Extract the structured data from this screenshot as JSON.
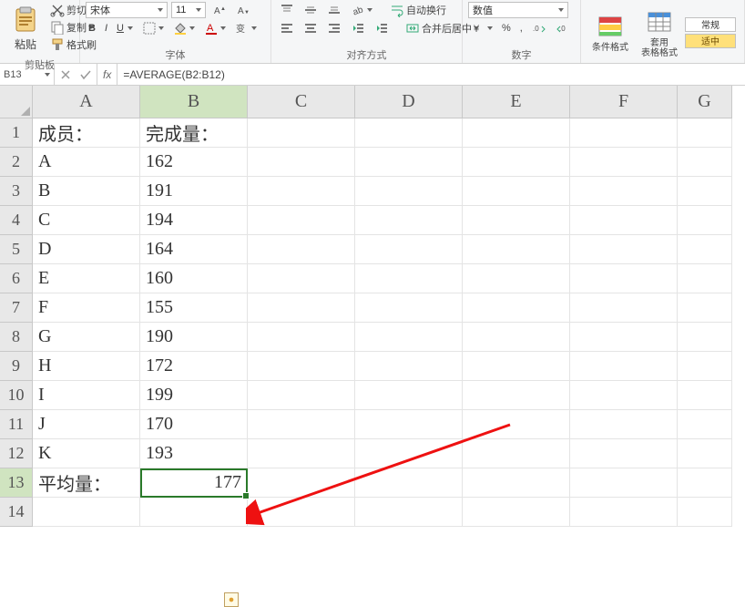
{
  "ribbon": {
    "clipboard": {
      "paste": "粘贴",
      "cut": "剪切",
      "copy": "复制",
      "format_painter": "格式刷",
      "group_label": "剪贴板"
    },
    "font": {
      "name": "宋体",
      "size": "11",
      "group_label": "字体"
    },
    "align": {
      "wrap": "自动换行",
      "merge": "合并后居中",
      "group_label": "对齐方式"
    },
    "number": {
      "format": "数值",
      "group_label": "数字"
    },
    "styles": {
      "cond_fmt": "条件格式",
      "table_fmt": "套用\n表格格式",
      "normal": "常规",
      "ok": "适中"
    }
  },
  "name_box": "B13",
  "formula": "=AVERAGE(B2:B12)",
  "columns": [
    "A",
    "B",
    "C",
    "D",
    "E",
    "F",
    "G"
  ],
  "header_row": {
    "a": "成员：",
    "b": "完成量："
  },
  "rows": [
    {
      "a": "A",
      "b": "162"
    },
    {
      "a": "B",
      "b": "191"
    },
    {
      "a": "C",
      "b": "194"
    },
    {
      "a": "D",
      "b": "164"
    },
    {
      "a": "E",
      "b": "160"
    },
    {
      "a": "F",
      "b": "155"
    },
    {
      "a": "G",
      "b": "190"
    },
    {
      "a": "H",
      "b": "172"
    },
    {
      "a": "I",
      "b": "199"
    },
    {
      "a": "J",
      "b": "170"
    },
    {
      "a": "K",
      "b": "193"
    }
  ],
  "summary": {
    "a": "平均量：",
    "b": "177"
  },
  "active_cell": "B13",
  "chart_data": {
    "type": "table",
    "title": "完成量",
    "categories": [
      "A",
      "B",
      "C",
      "D",
      "E",
      "F",
      "G",
      "H",
      "I",
      "J",
      "K"
    ],
    "values": [
      162,
      191,
      194,
      164,
      160,
      155,
      190,
      172,
      199,
      170,
      193
    ],
    "summary": {
      "label": "平均量：",
      "value": 177,
      "formula": "=AVERAGE(B2:B12)"
    }
  }
}
